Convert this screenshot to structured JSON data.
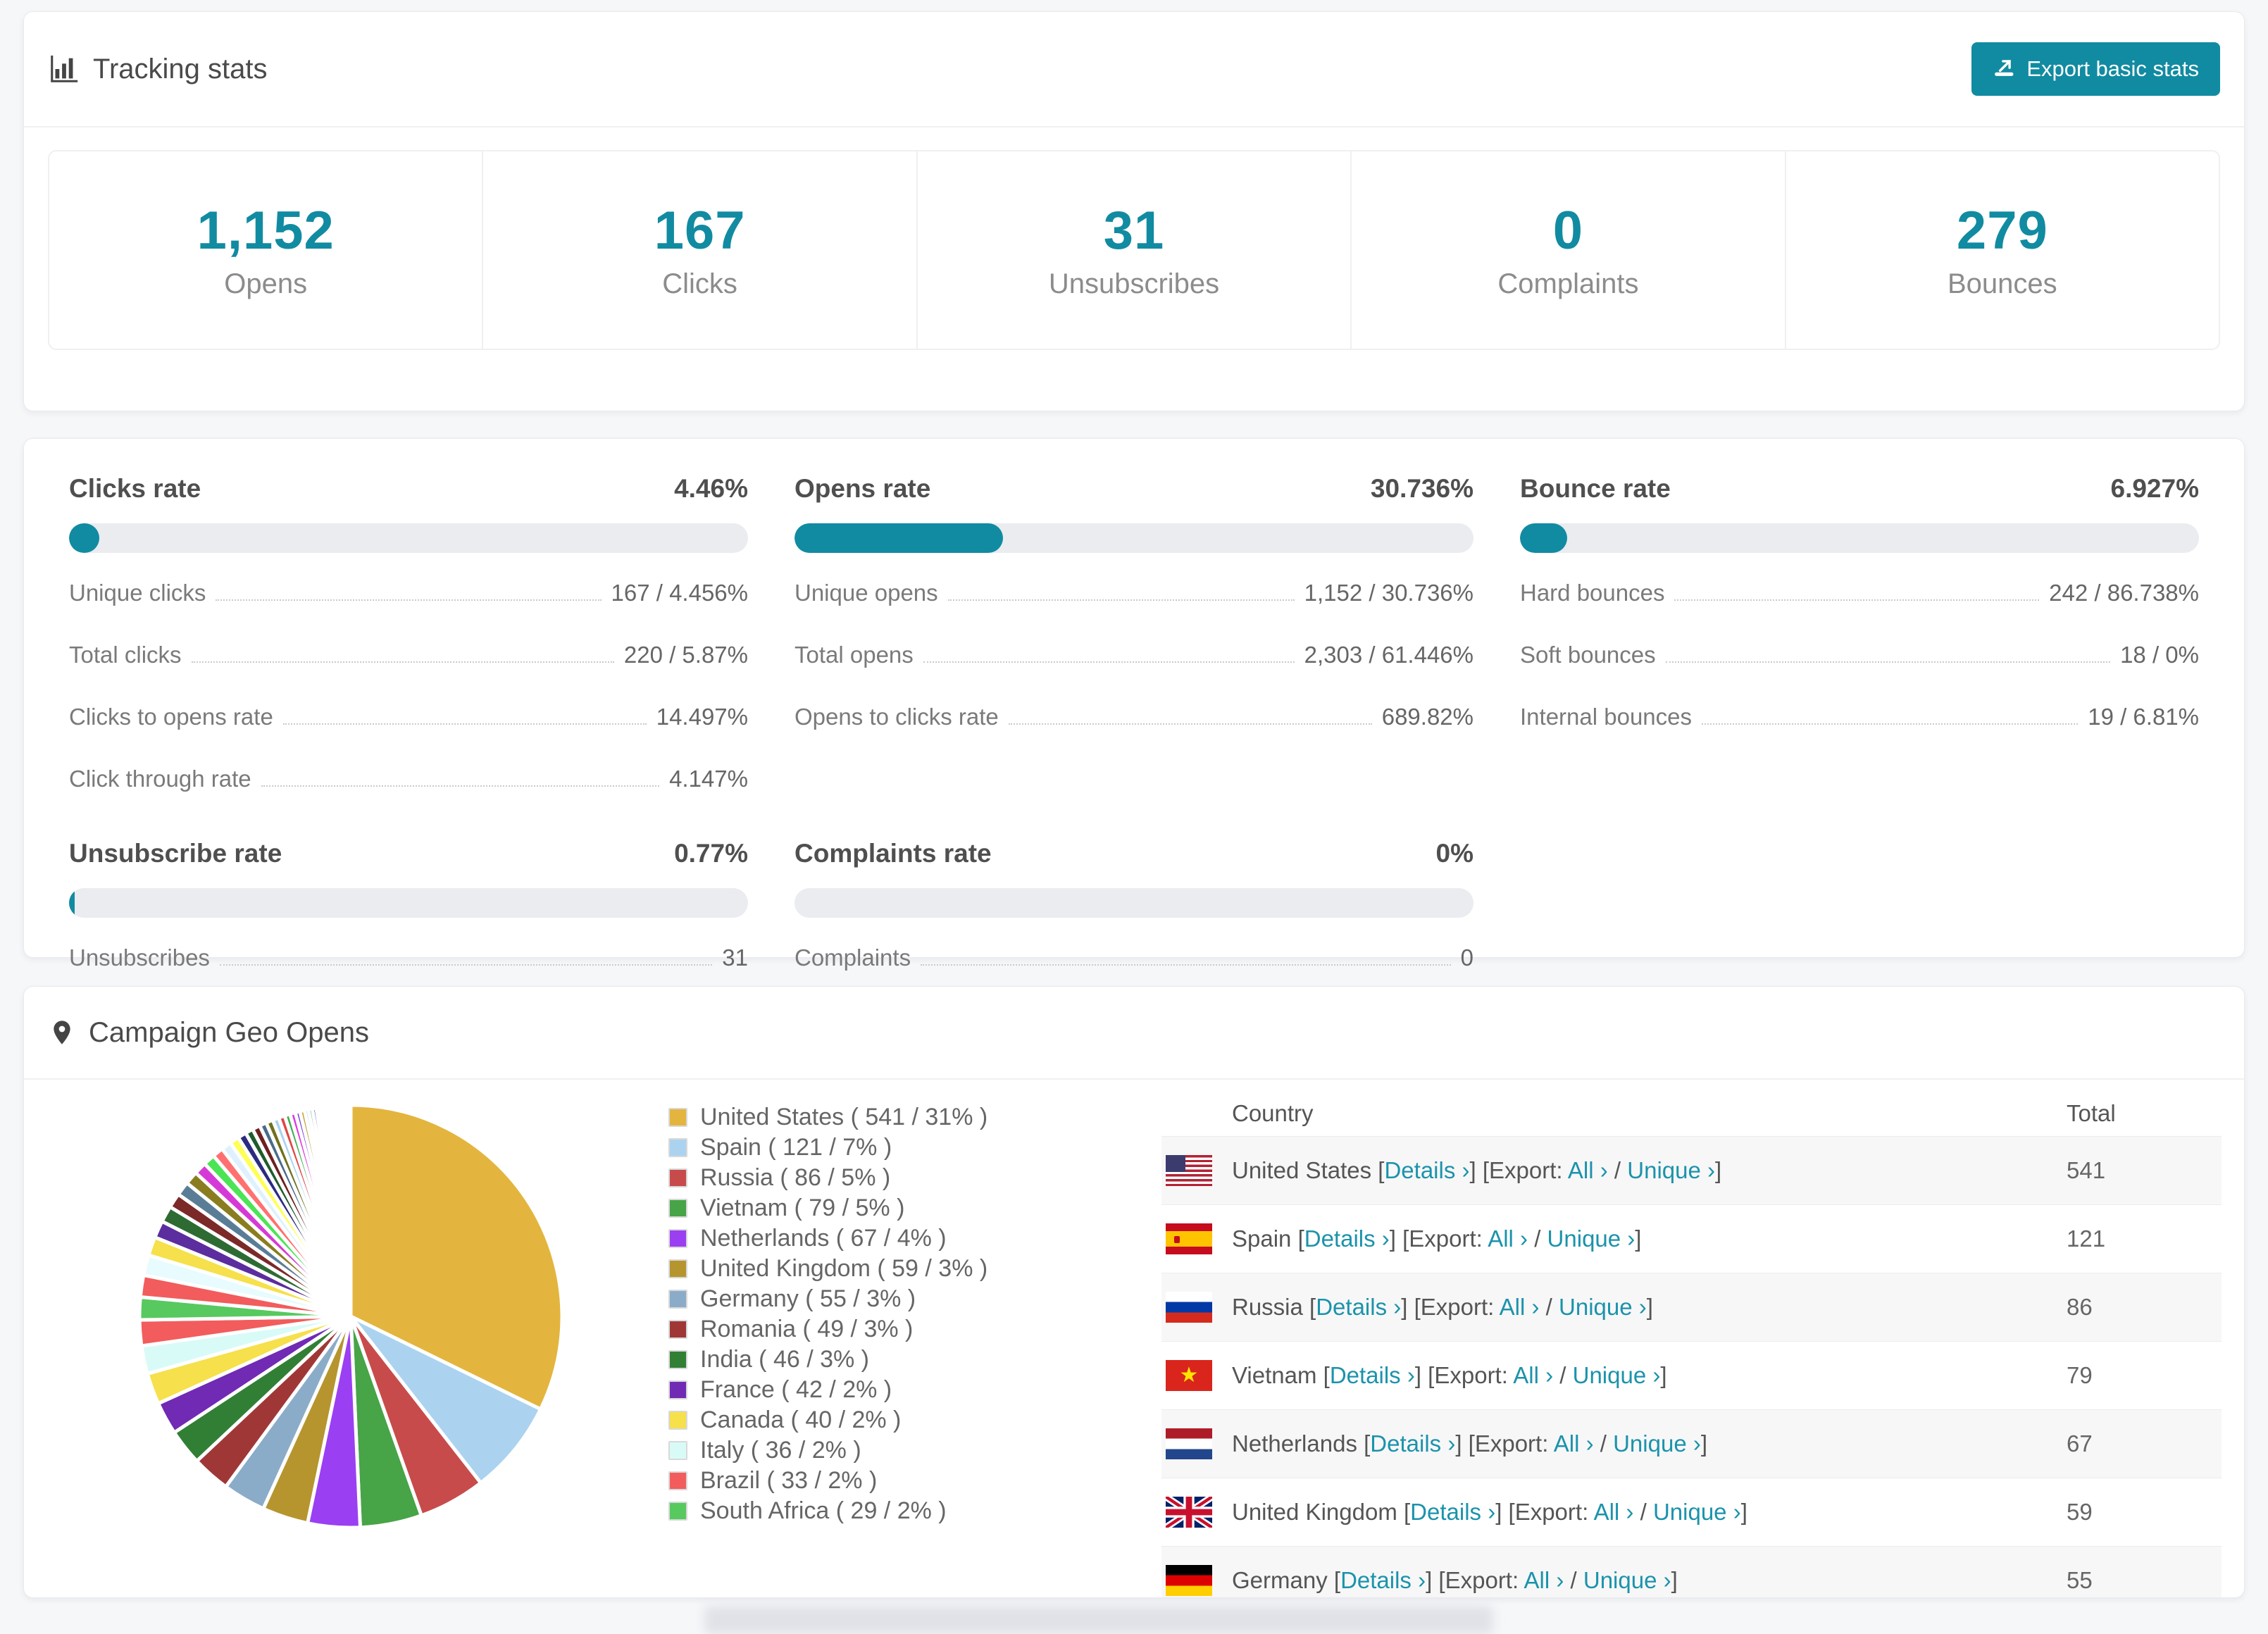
{
  "accent_color": "#118ba1",
  "tracking": {
    "title": "Tracking stats",
    "export_label": "Export basic stats",
    "stats": [
      {
        "value": "1,152",
        "label": "Opens"
      },
      {
        "value": "167",
        "label": "Clicks"
      },
      {
        "value": "31",
        "label": "Unsubscribes"
      },
      {
        "value": "0",
        "label": "Complaints"
      },
      {
        "value": "279",
        "label": "Bounces"
      }
    ]
  },
  "rates": {
    "blocks": [
      {
        "title": "Clicks rate",
        "value": "4.46%",
        "percent": 4.46,
        "rows": [
          {
            "label": "Unique clicks",
            "value": "167 / 4.456%"
          },
          {
            "label": "Total clicks",
            "value": "220 / 5.87%"
          },
          {
            "label": "Clicks to opens rate",
            "value": "14.497%"
          },
          {
            "label": "Click through rate",
            "value": "4.147%"
          }
        ]
      },
      {
        "title": "Opens rate",
        "value": "30.736%",
        "percent": 30.736,
        "rows": [
          {
            "label": "Unique opens",
            "value": "1,152 / 30.736%"
          },
          {
            "label": "Total opens",
            "value": "2,303 / 61.446%"
          },
          {
            "label": "Opens to clicks rate",
            "value": "689.82%"
          }
        ]
      },
      {
        "title": "Bounce rate",
        "value": "6.927%",
        "percent": 6.927,
        "rows": [
          {
            "label": "Hard bounces",
            "value": "242 / 86.738%"
          },
          {
            "label": "Soft bounces",
            "value": "18 / 0%"
          },
          {
            "label": "Internal bounces",
            "value": "19 / 6.81%"
          }
        ]
      },
      {
        "title": "Unsubscribe rate",
        "value": "0.77%",
        "percent": 0.77,
        "rows": [
          {
            "label": "Unsubscribes",
            "value": "31"
          }
        ]
      },
      {
        "title": "Complaints rate",
        "value": "0%",
        "percent": 0,
        "rows": [
          {
            "label": "Complaints",
            "value": "0"
          }
        ]
      }
    ]
  },
  "geo": {
    "title": "Campaign Geo Opens",
    "chart_data": {
      "type": "pie",
      "title": "Campaign Geo Opens",
      "legend_position": "right",
      "start_angle_deg": -90,
      "direction": "clockwise",
      "slices": [
        {
          "label": "United States",
          "value": 541,
          "pct": "31%",
          "color": "#e3b53e"
        },
        {
          "label": "Spain",
          "value": 121,
          "pct": "7%",
          "color": "#abd3f0"
        },
        {
          "label": "Russia",
          "value": 86,
          "pct": "5%",
          "color": "#c84b4c"
        },
        {
          "label": "Vietnam",
          "value": 79,
          "pct": "5%",
          "color": "#47a447"
        },
        {
          "label": "Netherlands",
          "value": 67,
          "pct": "4%",
          "color": "#9b3ff2"
        },
        {
          "label": "United Kingdom",
          "value": 59,
          "pct": "3%",
          "color": "#b6952f"
        },
        {
          "label": "Germany",
          "value": 55,
          "pct": "3%",
          "color": "#8bacc8"
        },
        {
          "label": "Romania",
          "value": 49,
          "pct": "3%",
          "color": "#a03737"
        },
        {
          "label": "India",
          "value": 46,
          "pct": "3%",
          "color": "#317f35"
        },
        {
          "label": "France",
          "value": 42,
          "pct": "2%",
          "color": "#702ab4"
        },
        {
          "label": "Canada",
          "value": 40,
          "pct": "2%",
          "color": "#f6e04b"
        },
        {
          "label": "Italy",
          "value": 36,
          "pct": "2%",
          "color": "#d9fbf7"
        },
        {
          "label": "Brazil",
          "value": 33,
          "pct": "2%",
          "color": "#f25c5c"
        },
        {
          "label": "South Africa",
          "value": 29,
          "pct": "2%",
          "color": "#57c95f"
        }
      ],
      "others_values": [
        28,
        26,
        24,
        22,
        21,
        19,
        18,
        17,
        16,
        15,
        14,
        13,
        12,
        11,
        10,
        10,
        9,
        9,
        8,
        8,
        7,
        7,
        6,
        6,
        5,
        5,
        5,
        4,
        4,
        4,
        3,
        3,
        3,
        3,
        2,
        2,
        2,
        2,
        2,
        2,
        1,
        1,
        1,
        1,
        1,
        1,
        1,
        1
      ],
      "others_palette": [
        "#f25c5c",
        "#e8fbff",
        "#f6e04b",
        "#5b2d9e",
        "#2e6b33",
        "#7c2929",
        "#5a7d97",
        "#8a7d20",
        "#d63ad6",
        "#4be455",
        "#ff7070",
        "#dff1ff",
        "#ffff55",
        "#2b2b80",
        "#1f5c2b",
        "#6e2020",
        "#4a6b8b",
        "#70701f",
        "#abd3f0",
        "#e04545",
        "#3fae4e",
        "#e03ae0",
        "#7b44e0",
        "#c3a232",
        "#93c9f5",
        "#43a04a",
        "#31339e"
      ]
    },
    "legend_format": "{label} ( {value} / {pct} )",
    "table": {
      "headers": [
        "Country",
        "Total"
      ],
      "link_labels": {
        "details": "Details ›",
        "export_prefix": "Export:",
        "all": "All ›",
        "unique": "Unique ›"
      },
      "rows": [
        {
          "flag": "us",
          "country": "United States",
          "total": "541"
        },
        {
          "flag": "es",
          "country": "Spain",
          "total": "121"
        },
        {
          "flag": "ru",
          "country": "Russia",
          "total": "86"
        },
        {
          "flag": "vn",
          "country": "Vietnam",
          "total": "79"
        },
        {
          "flag": "nl",
          "country": "Netherlands",
          "total": "67"
        },
        {
          "flag": "gb",
          "country": "United Kingdom",
          "total": "59"
        },
        {
          "flag": "de",
          "country": "Germany",
          "total": "55"
        }
      ]
    }
  }
}
